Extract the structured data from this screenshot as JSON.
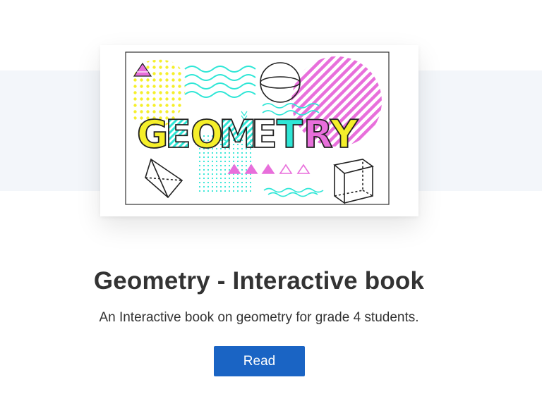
{
  "cover": {
    "word": "GEOMETRY",
    "letters": [
      "G",
      "E",
      "O",
      "M",
      "E",
      "T",
      "R",
      "Y"
    ],
    "colors": {
      "yellow": "#f5ef2a",
      "cyan": "#2ee6d6",
      "magenta": "#e86fdb",
      "outline": "#222222"
    }
  },
  "book": {
    "title": "Geometry - Interactive book",
    "description": "An Interactive book on geometry for grade 4 students.",
    "read_label": "Read"
  },
  "colors": {
    "button": "#1a64c4",
    "band": "#f3f6fa",
    "text": "#333333"
  }
}
